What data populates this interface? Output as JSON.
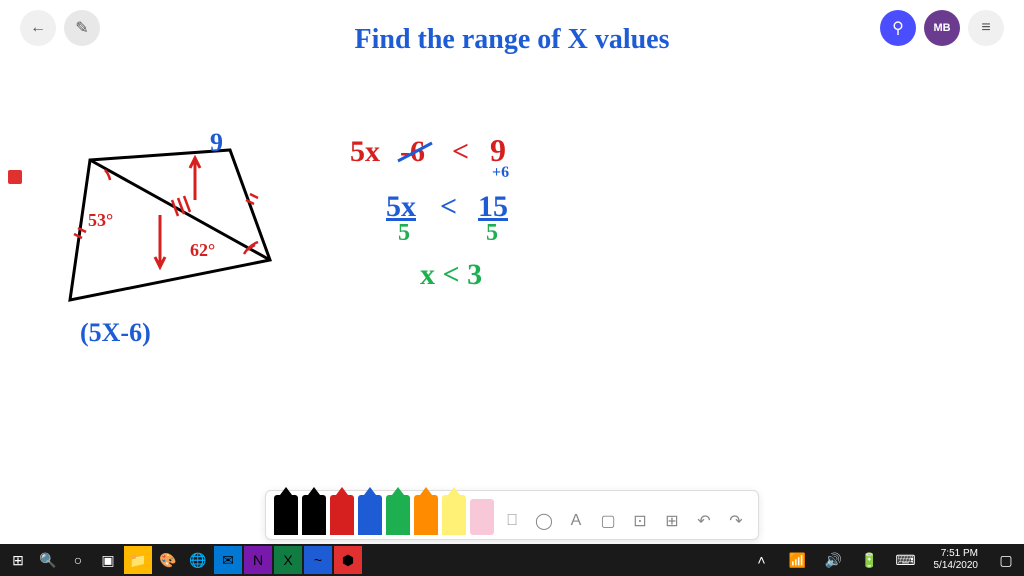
{
  "title": "Find the range of X values",
  "user_initials": "MB",
  "diagram": {
    "top_label": "9",
    "bottom_label": "(5X-6)",
    "angle1": "53°",
    "angle2": "62°"
  },
  "work": {
    "line1_lhs": "5x",
    "line1_strike": "-6",
    "line1_op": "<",
    "line1_rhs": "9",
    "line1_plus": "+6",
    "line2_lhs": "5x",
    "line2_div1": "5",
    "line2_op": "<",
    "line2_rhs": "15",
    "line2_div2": "5",
    "line3": "x < 3"
  },
  "pens": [
    {
      "color": "#000000"
    },
    {
      "color": "#000000"
    },
    {
      "color": "#d62020"
    },
    {
      "color": "#1e5cd6"
    },
    {
      "color": "#1eb050"
    },
    {
      "color": "#ff8c00"
    },
    {
      "color": "#fff176"
    }
  ],
  "tray_tools": {
    "eraser": "▯",
    "ruler": "⎕",
    "lasso": "◯",
    "text": "A",
    "shape": "▢",
    "image": "⊡",
    "add": "⊞",
    "undo": "↶",
    "redo": "↷"
  },
  "taskbar": {
    "time": "7:51 PM",
    "date": "5/14/2020"
  },
  "icons": {
    "back": "←",
    "pen_mode": "✎",
    "share": "⚲",
    "menu": "≡"
  }
}
